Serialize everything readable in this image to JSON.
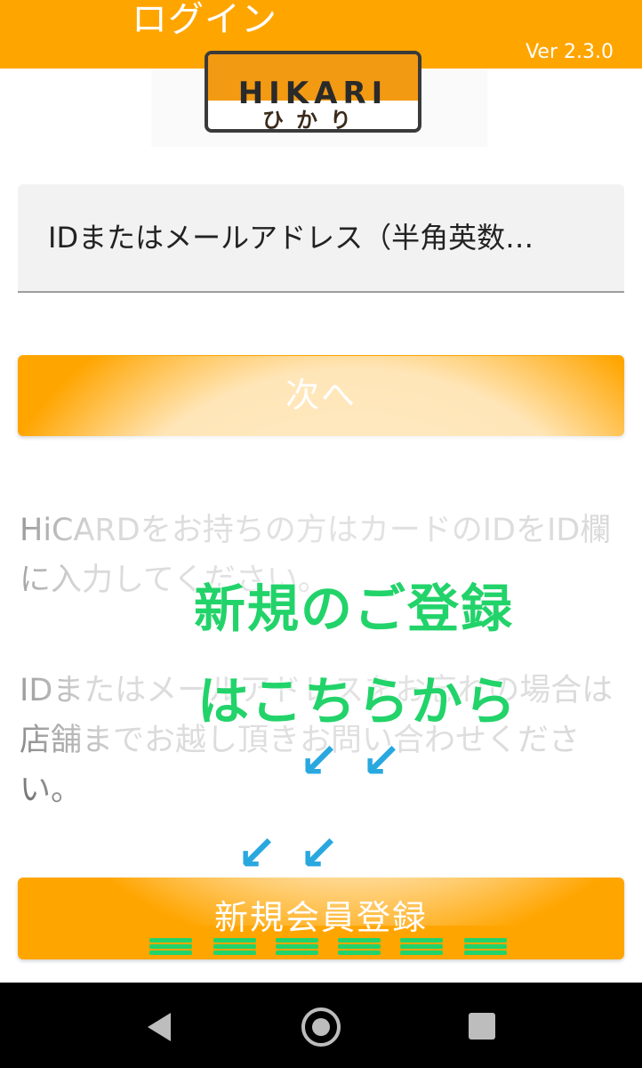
{
  "header": {
    "title": "ログイン",
    "version": "Ver 2.3.0",
    "color": "#FFA500"
  },
  "logo": {
    "brand": "HIKARI",
    "sub": "ひかり"
  },
  "login": {
    "id_placeholder": "IDまたはメールアドレス（半角英数…",
    "next_label": "次へ",
    "info_card": "HiCARDをお持ちの方はカードのIDをID欄に入力してください。",
    "info_forgot": "IDまたはメールアドレスをお忘れの場合は店舗までお越し頂きお問い合わせください。",
    "register_label": "新規会員登録"
  },
  "annotation": {
    "line1": "新規のご登録",
    "line2": "はこちらから",
    "text_color": "#22D36A",
    "arrow_color": "#29A8E0",
    "arrow_glyph": "↙"
  },
  "navbar": {
    "icons": [
      "back-icon",
      "home-icon",
      "recent-apps-icon"
    ]
  }
}
